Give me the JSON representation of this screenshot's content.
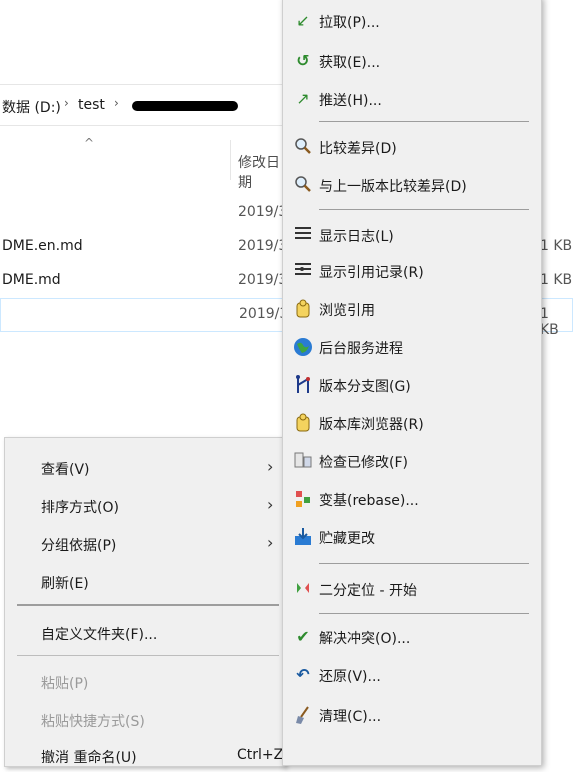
{
  "breadcrumb": {
    "drive": "数据 (D:)",
    "folder": "test"
  },
  "file_list": {
    "column_date": "修改日期",
    "rows": [
      {
        "name": "",
        "date": "2019/3/",
        "size": ""
      },
      {
        "name": "DME.en.md",
        "date": "2019/3/",
        "size": "1 KB"
      },
      {
        "name": "DME.md",
        "date": "2019/3/",
        "size": "1 KB"
      },
      {
        "name": "",
        "date": "2019/3/",
        "size": "1 KB"
      }
    ]
  },
  "context_menu": {
    "view": "查看(V)",
    "sort_by": "排序方式(O)",
    "group_by": "分组依据(P)",
    "refresh": "刷新(E)",
    "customize_folder": "自定义文件夹(F)...",
    "paste": "粘贴(P)",
    "paste_shortcut": "粘贴快捷方式(S)",
    "undo_rename": "撤消 重命名(U)",
    "undo_shortcut": "Ctrl+Z"
  },
  "tortoise_menu": {
    "pull": "拉取(P)...",
    "fetch": "获取(E)...",
    "push": "推送(H)...",
    "diff": "比较差异(D)",
    "diff_prev": "与上一版本比较差异(D)",
    "show_log": "显示日志(L)",
    "show_reflog": "显示引用记录(R)",
    "browse_refs": "浏览引用",
    "daemon": "后台服务进程",
    "revision_graph": "版本分支图(G)",
    "repo_browser": "版本库浏览器(R)",
    "check_modifications": "检查已修改(F)",
    "rebase": "变基(rebase)...",
    "stash": "贮藏更改",
    "bisect": "二分定位 - 开始",
    "resolve": "解决冲突(O)...",
    "revert": "还原(V)...",
    "cleanup": "清理(C)..."
  }
}
